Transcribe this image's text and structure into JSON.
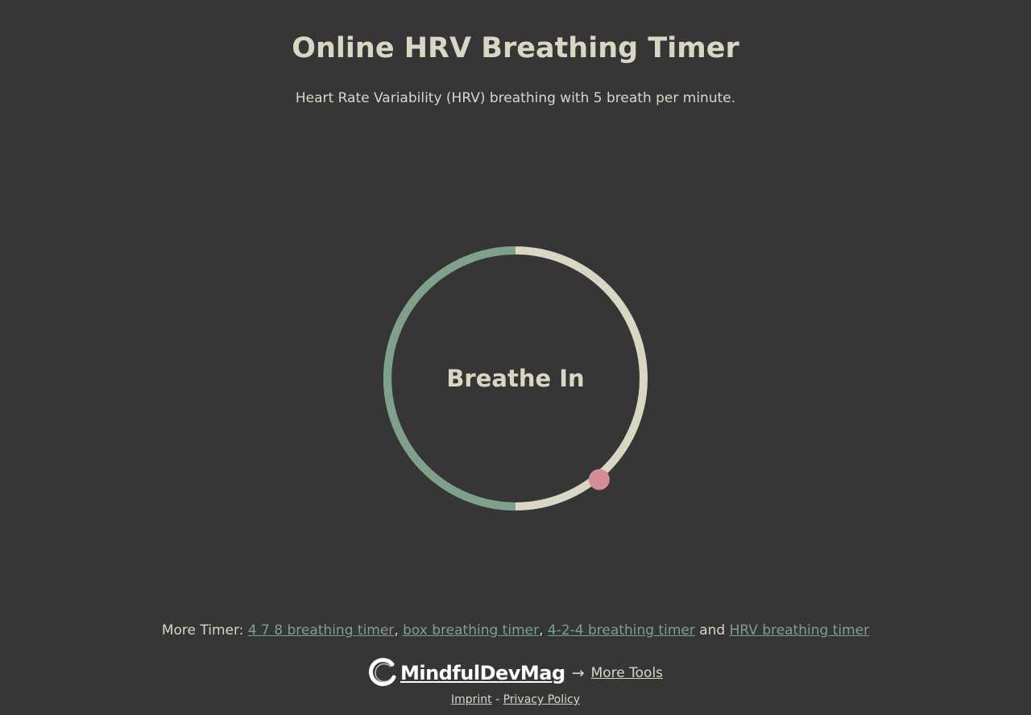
{
  "header": {
    "title": "Online HRV Breathing Timer",
    "subtitle": "Heart Rate Variability (HRV) breathing with 5 breath per minute."
  },
  "timer": {
    "phase_label": "Breathe In",
    "progress_fraction": 0.39,
    "colors": {
      "track": "#d9d7c4",
      "progress": "#7fa08b",
      "indicator": "#d48d95",
      "background": "#363636"
    }
  },
  "more_timers": {
    "prefix": "More Timer: ",
    "links": [
      "4 7 8 breathing timer",
      "box breathing timer",
      "4-2-4 breathing timer",
      "HRV breathing timer"
    ],
    "separator": ", ",
    "conjunction": " and "
  },
  "brand": {
    "logo_text": "MindfulDevMag",
    "arrow": "→",
    "more_tools": "More Tools"
  },
  "footer": {
    "imprint": "Imprint",
    "divider": " - ",
    "privacy": "Privacy Policy"
  }
}
